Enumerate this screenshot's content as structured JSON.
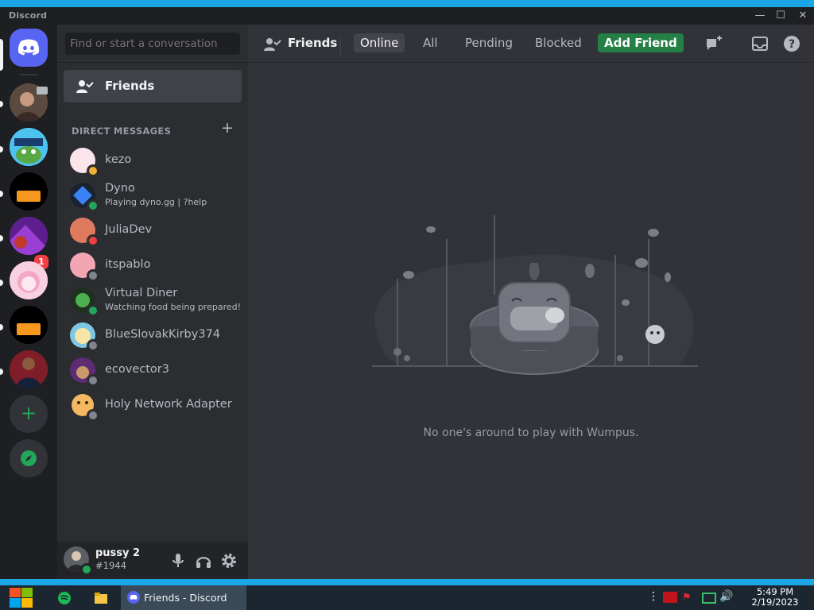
{
  "app": {
    "title": "Discord"
  },
  "window_controls": {
    "minimize": "—",
    "maximize": "☐",
    "close": "✕"
  },
  "guilds": {
    "unread_badge": "1"
  },
  "sidebar": {
    "search_placeholder": "Find or start a conversation",
    "friends_label": "Friends",
    "dm_header": "DIRECT MESSAGES",
    "dm_add": "+",
    "dms": [
      {
        "name": "kezo",
        "activity": "",
        "status_color": "#f0b232"
      },
      {
        "name": "Dyno",
        "activity": "Playing dyno.gg | ?help",
        "status_color": "#23a55a"
      },
      {
        "name": "JuliaDev",
        "activity": "",
        "status_color": "#f23f43"
      },
      {
        "name": "itspablo",
        "activity": "",
        "status_color": "#80848e"
      },
      {
        "name": "Virtual Diner",
        "activity": "Watching food being prepared!",
        "status_color": "#23a55a"
      },
      {
        "name": "BlueSlovakKirby374",
        "activity": "",
        "status_color": "#80848e"
      },
      {
        "name": "ecovector3",
        "activity": "",
        "status_color": "#80848e"
      },
      {
        "name": "Holy Network Adapter",
        "activity": "",
        "status_color": "#80848e"
      }
    ]
  },
  "user": {
    "name": "pussy 2",
    "discriminator": "#1944"
  },
  "header": {
    "title": "Friends",
    "tabs": [
      {
        "label": "Online",
        "selected": true
      },
      {
        "label": "All",
        "selected": false
      },
      {
        "label": "Pending",
        "selected": false
      },
      {
        "label": "Blocked",
        "selected": false
      }
    ],
    "add_friend": "Add Friend"
  },
  "main": {
    "empty_message": "No one's around to play with Wumpus."
  },
  "taskbar": {
    "active_window": "Friends - Discord",
    "time": "5:49 PM",
    "date": "2/19/2023"
  },
  "colors": {
    "accent": "#5865f2",
    "green": "#23a55a",
    "sidebar": "#2b2d31",
    "main": "#313338"
  }
}
